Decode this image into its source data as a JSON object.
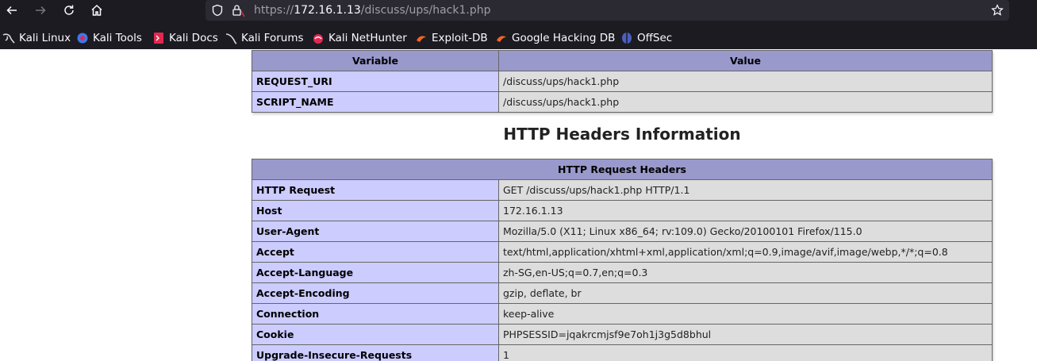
{
  "browser": {
    "url_prefix": "https://",
    "url_host": "172.16.1.13",
    "url_path": "/discuss/ups/hack1.php",
    "bookmarks": [
      {
        "label": "Kali Linux",
        "icon": "kali-dragon-icon"
      },
      {
        "label": "Kali Tools",
        "icon": "kali-tools-icon"
      },
      {
        "label": "Kali Docs",
        "icon": "kali-docs-icon"
      },
      {
        "label": "Kali Forums",
        "icon": "kali-forums-icon"
      },
      {
        "label": "Kali NetHunter",
        "icon": "kali-nethunter-icon"
      },
      {
        "label": "Exploit-DB",
        "icon": "exploit-db-icon"
      },
      {
        "label": "Google Hacking DB",
        "icon": "ghdb-icon"
      },
      {
        "label": "OffSec",
        "icon": "offsec-icon"
      }
    ]
  },
  "server_table": {
    "headers": [
      "Variable",
      "Value"
    ],
    "rows": [
      {
        "name": "REQUEST_URI",
        "value": "/discuss/ups/hack1.php"
      },
      {
        "name": "SCRIPT_NAME",
        "value": "/discuss/ups/hack1.php"
      }
    ]
  },
  "headers_section": {
    "title": "HTTP Headers Information",
    "table_header": "HTTP Request Headers",
    "rows": [
      {
        "name": "HTTP Request",
        "value": "GET /discuss/ups/hack1.php HTTP/1.1"
      },
      {
        "name": "Host",
        "value": "172.16.1.13"
      },
      {
        "name": "User-Agent",
        "value": "Mozilla/5.0 (X11; Linux x86_64; rv:109.0) Gecko/20100101 Firefox/115.0"
      },
      {
        "name": "Accept",
        "value": "text/html,application/xhtml+xml,application/xml;q=0.9,image/avif,image/webp,*/*;q=0.8"
      },
      {
        "name": "Accept-Language",
        "value": "zh-SG,en-US;q=0.7,en;q=0.3"
      },
      {
        "name": "Accept-Encoding",
        "value": "gzip, deflate, br"
      },
      {
        "name": "Connection",
        "value": "keep-alive"
      },
      {
        "name": "Cookie",
        "value": "PHPSESSID=jqakrcmjsf9e7oh1j3g5d8bhul"
      },
      {
        "name": "Upgrade-Insecure-Requests",
        "value": "1"
      }
    ]
  }
}
